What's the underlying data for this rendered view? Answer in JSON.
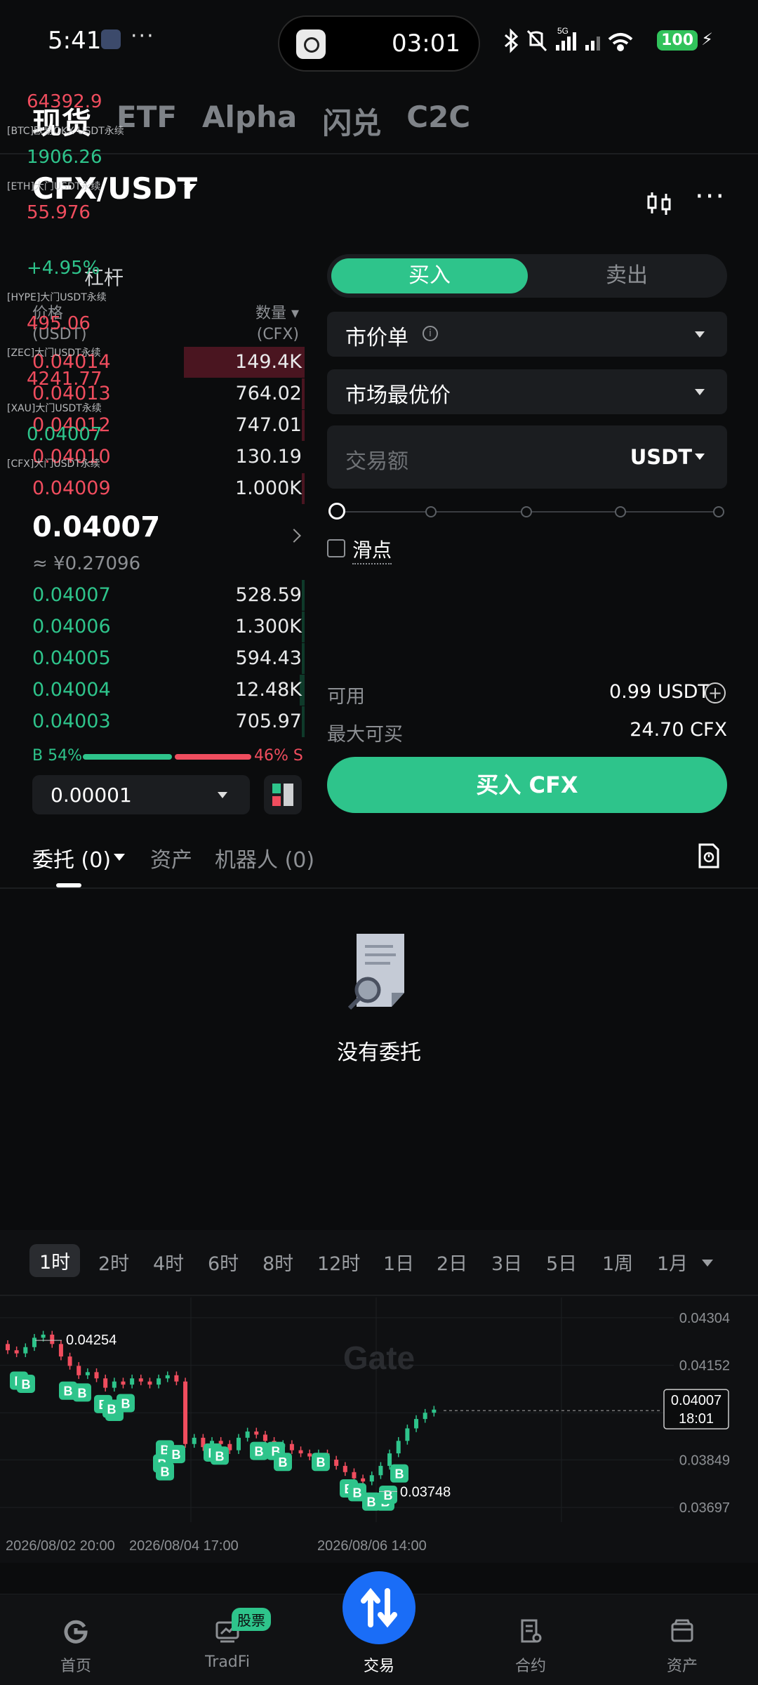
{
  "status_bar": {
    "time": "5:41",
    "island_time": "03:01",
    "network": "5G",
    "battery": "100"
  },
  "top_tabs": [
    "现货",
    "ETF",
    "Alpha",
    "闪兑",
    "C2C"
  ],
  "ticker_overlay": [
    {
      "price": "64392.9",
      "name": "[BTC]欧易OKX USDT永续",
      "color": "red"
    },
    {
      "price": "1906.26",
      "name": "[ETH]大门USDT永续",
      "color": "green"
    },
    {
      "price": "55.976",
      "name": "",
      "color": "red"
    },
    {
      "price": "+4.95%",
      "name": "[HYPE]大门USDT永续",
      "color": "green"
    },
    {
      "price": "495.06",
      "name": "[ZEC]大门USDT永续",
      "color": "red"
    },
    {
      "price": "4241.77",
      "name": "[XAU]大门USDT永续",
      "color": "red"
    },
    {
      "price": "0.04007",
      "name": "[CFX]大门USDT永续",
      "color": "green"
    }
  ],
  "pair": {
    "symbol": "CFX/USDT",
    "leverage_label": "杠杆"
  },
  "order_book": {
    "price_header": "价格",
    "price_unit": "(USDT)",
    "qty_header": "数量",
    "qty_unit": "(CFX)",
    "asks": [
      {
        "price": "0.04014",
        "qty": "149.4K",
        "depth": 1.0
      },
      {
        "price": "0.04013",
        "qty": "764.02",
        "depth": 0.02
      },
      {
        "price": "0.04012",
        "qty": "747.01",
        "depth": 0.02
      },
      {
        "price": "0.04010",
        "qty": "130.19",
        "depth": 0.0
      },
      {
        "price": "0.04009",
        "qty": "1.000K",
        "depth": 0.02
      }
    ],
    "last_price": "0.04007",
    "fiat_price": "≈ ¥0.27096",
    "bids": [
      {
        "price": "0.04007",
        "qty": "528.59",
        "depth": 0.02
      },
      {
        "price": "0.04006",
        "qty": "1.300K",
        "depth": 0.02
      },
      {
        "price": "0.04005",
        "qty": "594.43",
        "depth": 0.02
      },
      {
        "price": "0.04004",
        "qty": "12.48K",
        "depth": 0.04
      },
      {
        "price": "0.04003",
        "qty": "705.97",
        "depth": 0.02
      }
    ],
    "buy_ratio": "B 54%",
    "sell_ratio": "46% S",
    "buy_ratio_value": 54,
    "precision": "0.00001"
  },
  "trade_form": {
    "buy_tab": "买入",
    "sell_tab": "卖出",
    "order_type": "市价单",
    "price_type": "市场最优价",
    "amount_placeholder": "交易额",
    "amount_unit": "USDT",
    "slider_value": 0,
    "slippage_label": "滑点",
    "available_label": "可用",
    "available_value": "0.99 USDT",
    "max_buy_label": "最大可买",
    "max_buy_value": "24.70 CFX",
    "buy_button": "买入 CFX"
  },
  "order_tabs": {
    "orders": "委托 (0)",
    "assets": "资产",
    "bots": "机器人 (0)",
    "empty_text": "没有委托"
  },
  "chart": {
    "timeframes": [
      "1时",
      "2时",
      "4时",
      "6时",
      "8时",
      "12时",
      "1日",
      "2日",
      "3日",
      "5日",
      "1周",
      "1月"
    ],
    "active_timeframe": "1时",
    "watermark": "Gate",
    "current_label": "0.04007",
    "current_time": "18:01",
    "high_label": "0.04254",
    "low_label": "0.03748",
    "y_ticks": [
      "0.04304",
      "0.04152",
      "0.03849",
      "0.03697"
    ],
    "x_ticks": [
      "2026/08/02 20:00",
      "2026/08/04 17:00",
      "2026/08/06 14:00"
    ],
    "marker_label": "B"
  },
  "chart_data": {
    "type": "candlestick",
    "title": "",
    "xlabel": "",
    "ylabel": "",
    "ylim": [
      0.0365,
      0.0436
    ],
    "x": [
      "2026/08/02 20:00",
      "2026/08/04 17:00",
      "2026/08/06 14:00"
    ],
    "series": [
      {
        "name": "",
        "close": [
          0.042,
          0.0419,
          0.0421,
          0.0424,
          0.0425,
          0.0422,
          0.0418,
          0.0415,
          0.0412,
          0.0413,
          0.0411,
          0.0408,
          0.041,
          0.0409,
          0.0411,
          0.041,
          0.0409,
          0.0411,
          0.0412,
          0.041,
          0.039,
          0.0392,
          0.0389,
          0.0391,
          0.039,
          0.0388,
          0.0392,
          0.0394,
          0.0393,
          0.0391,
          0.0389,
          0.039,
          0.0388,
          0.0387,
          0.0386,
          0.0387,
          0.0385,
          0.0383,
          0.0381,
          0.0379,
          0.0378,
          0.038,
          0.0383,
          0.0387,
          0.0391,
          0.0395,
          0.0398,
          0.04,
          0.0401
        ]
      }
    ]
  },
  "bottom_nav": {
    "items": [
      "首页",
      "TradFi",
      "交易",
      "合约",
      "资产"
    ],
    "badge": "股票"
  }
}
